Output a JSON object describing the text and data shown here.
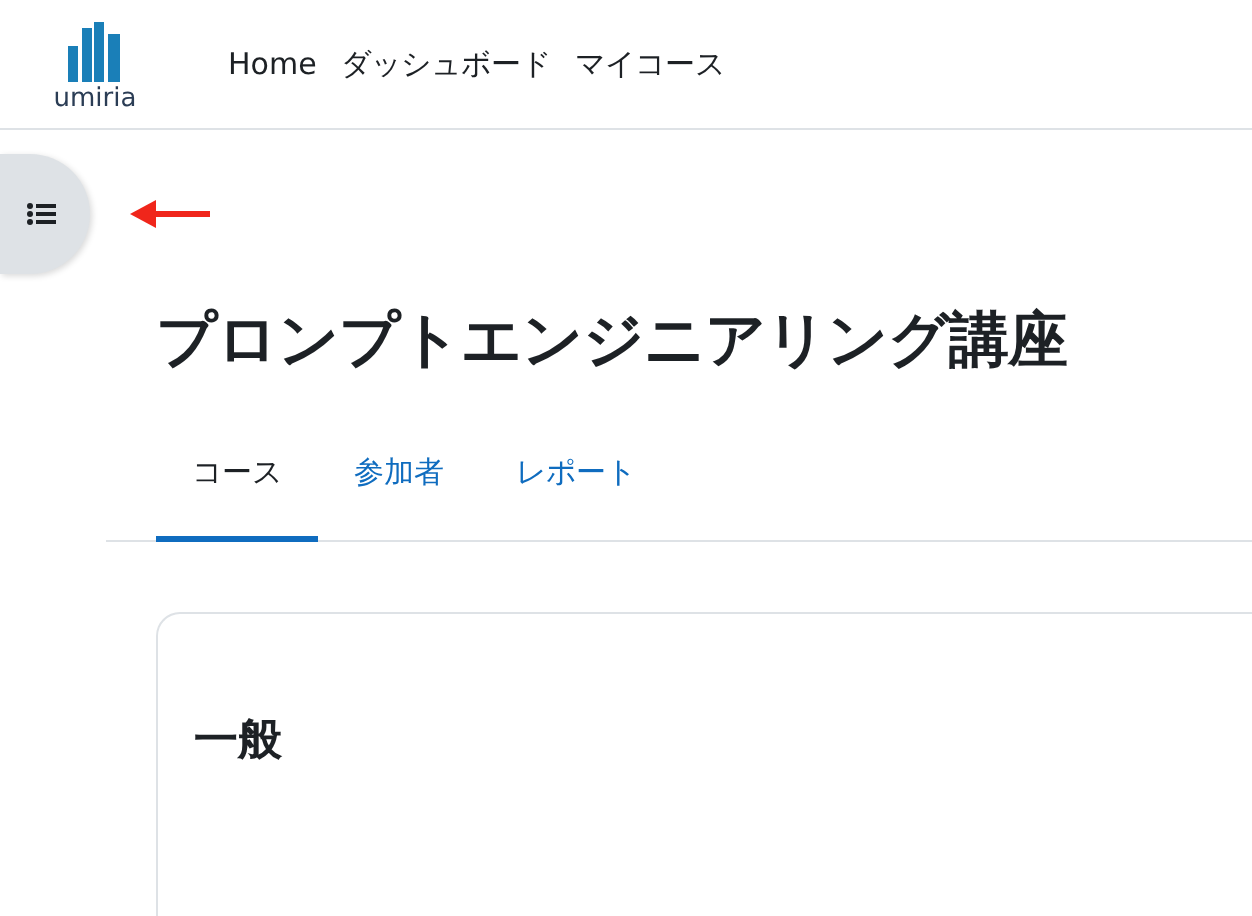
{
  "header": {
    "logo_text": "umiria",
    "nav": [
      {
        "label": "Home"
      },
      {
        "label": "ダッシュボード"
      },
      {
        "label": "マイコース"
      }
    ]
  },
  "course": {
    "title": "プロンプトエンジニアリング講座",
    "tabs": [
      {
        "label": "コース",
        "selected": true
      },
      {
        "label": "参加者",
        "selected": false
      },
      {
        "label": "レポート",
        "selected": false
      }
    ],
    "section": {
      "title": "一般"
    }
  }
}
